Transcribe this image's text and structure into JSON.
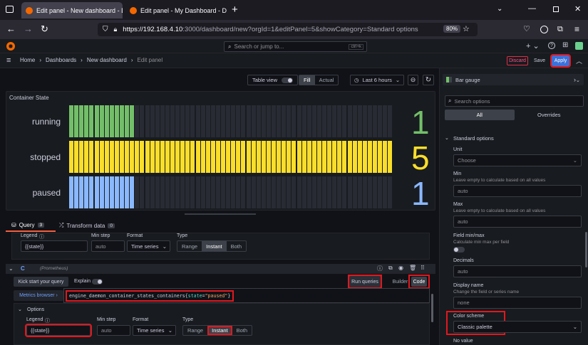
{
  "browser": {
    "tabs": [
      {
        "title": "Edit panel - New dashboard - D",
        "active": true
      },
      {
        "title": "Edit panel - My Dashboard - Da",
        "active": false
      }
    ],
    "url": {
      "host": "https://192.168.4.10",
      "rest": ":3000/dashboard/new?orgId=1&editPanel=5&showCategory=Standard options"
    },
    "zoom": "80%"
  },
  "grafana": {
    "search_placeholder": "Search or jump to...",
    "search_shortcut": "ctrl+k",
    "breadcrumb": [
      "Home",
      "Dashboards",
      "New dashboard",
      "Edit panel"
    ],
    "discard_label": "Discard",
    "save_label": "Save",
    "apply_label": "Apply"
  },
  "toolbar": {
    "table_view": "Table view",
    "fill": "Fill",
    "actual": "Actual",
    "time_range": "Last 6 hours"
  },
  "panel": {
    "title": "Container State"
  },
  "chart_data": {
    "type": "bar",
    "categories": [
      "running",
      "stopped",
      "paused"
    ],
    "values": [
      1,
      5,
      1
    ],
    "ylim": [
      0,
      5
    ],
    "colors": [
      "#73bf69",
      "#fade2a",
      "#8ab8ff"
    ]
  },
  "query": {
    "tab_query": "Query",
    "query_count": "3",
    "tab_transform": "Transform data",
    "transform_count": "0",
    "row_b": {
      "legend_label": "Legend",
      "legend_value": "{{state}}",
      "minstep_label": "Min step",
      "minstep_placeholder": "auto",
      "format_label": "Format",
      "format_value": "Time series",
      "type_label": "Type",
      "types": [
        "Range",
        "Instant",
        "Both"
      ]
    },
    "row_c": {
      "ref": "C",
      "datasource": "(Prometheus)",
      "kick_start": "Kick start your query",
      "explain": "Explain",
      "run_queries": "Run queries",
      "builder": "Builder",
      "code": "Code",
      "metrics_browser": "Metrics browser",
      "expr_metric": "engine_daemon_container_states_containers{",
      "expr_label": "state",
      "expr_eq": "=",
      "expr_value": "\"paused\"",
      "expr_close": "}",
      "options": "Options",
      "legend_label": "Legend",
      "legend_value": "{{state}}",
      "minstep_label": "Min step",
      "minstep_placeholder": "auto",
      "format_label": "Format",
      "format_value": "Time series",
      "type_label": "Type",
      "types": [
        "Range",
        "Instant",
        "Both"
      ]
    }
  },
  "options": {
    "viz": "Bar gauge",
    "search_placeholder": "Search options",
    "tab_all": "All",
    "tab_overrides": "Overrides",
    "section": "Standard options",
    "unit_label": "Unit",
    "unit_value": "Choose",
    "min_label": "Min",
    "min_desc": "Leave empty to calculate based on all values",
    "min_placeholder": "auto",
    "max_label": "Max",
    "max_desc": "Leave empty to calculate based on all values",
    "max_placeholder": "auto",
    "fieldminmax_label": "Field min/max",
    "fieldminmax_desc": "Calculate min max per field",
    "decimals_label": "Decimals",
    "decimals_placeholder": "auto",
    "displayname_label": "Display name",
    "displayname_desc": "Change the field or series name",
    "displayname_placeholder": "none",
    "colorscheme_label": "Color scheme",
    "colorscheme_value": "Classic palette",
    "novalue_label": "No value"
  }
}
